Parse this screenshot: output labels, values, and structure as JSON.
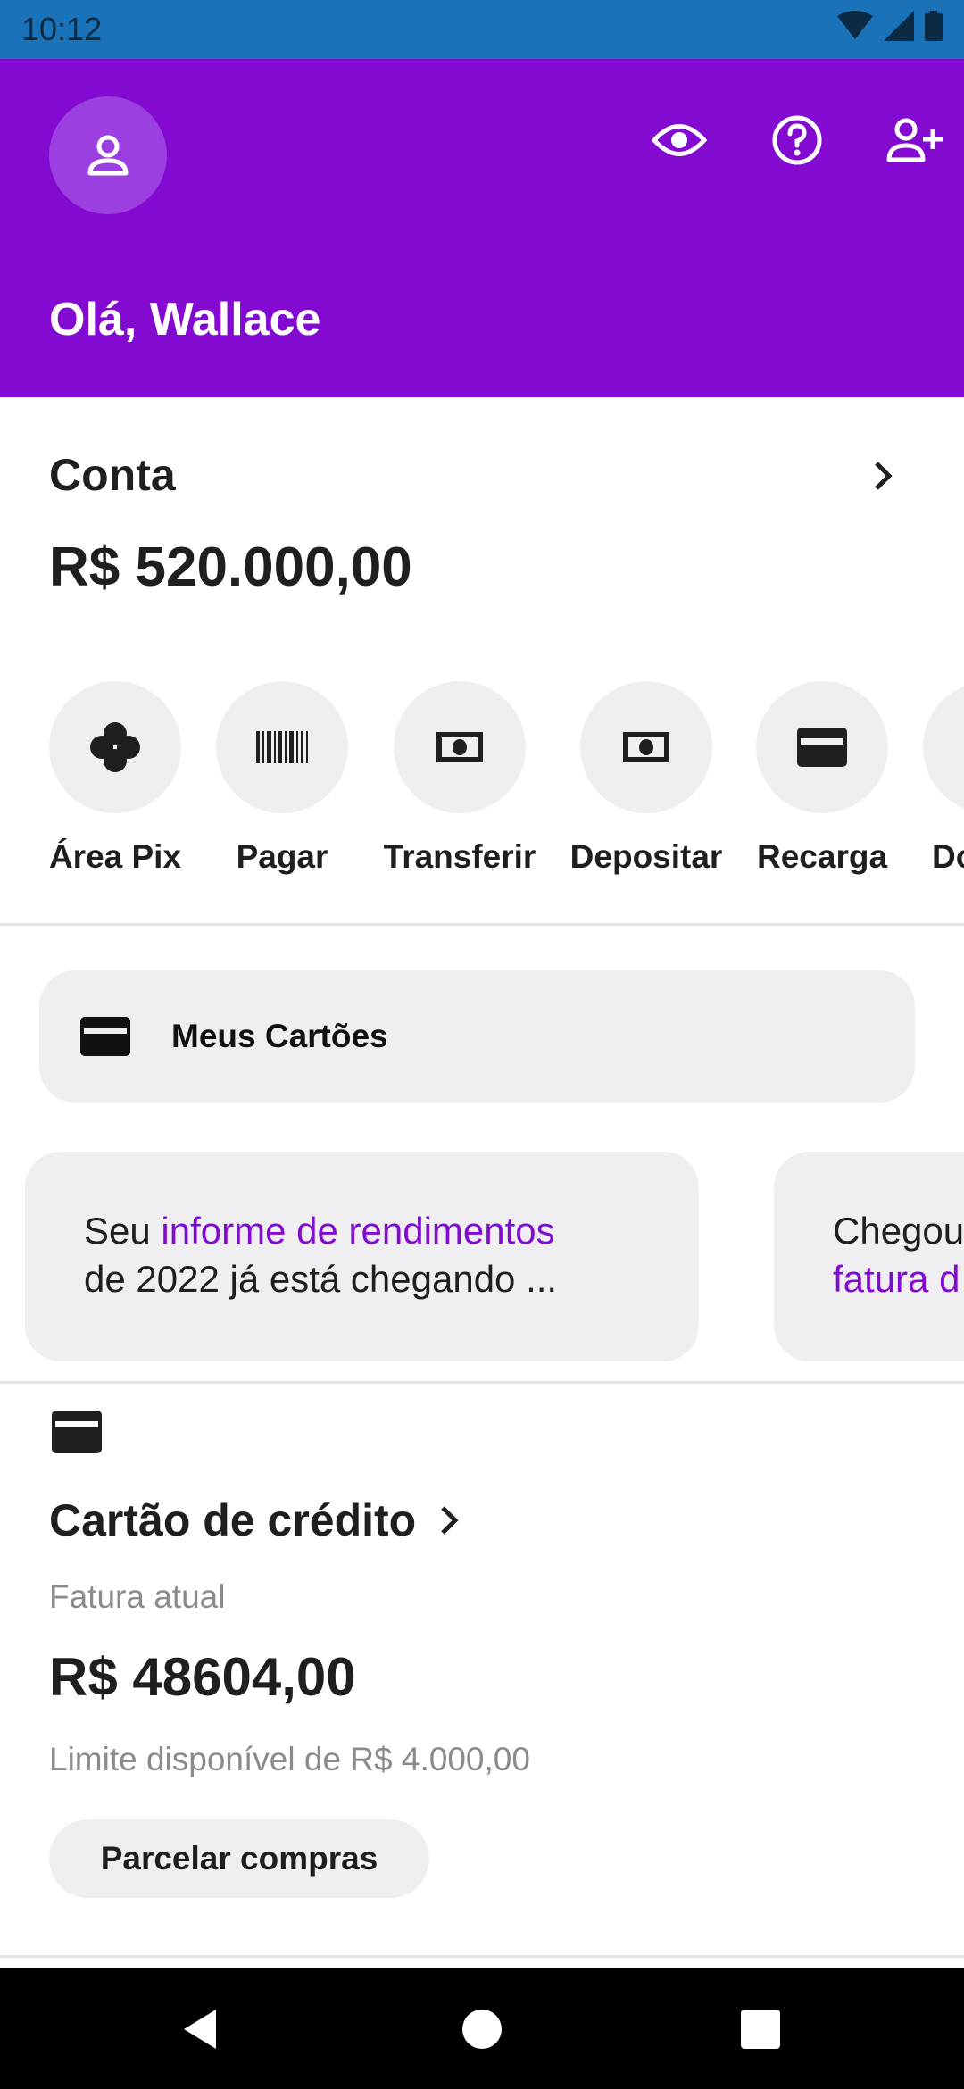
{
  "status": {
    "time": "10:12"
  },
  "header": {
    "greeting": "Olá, Wallace",
    "actions": [
      "eye-icon",
      "help-icon",
      "add-user-icon"
    ],
    "color": "#820ad1"
  },
  "account": {
    "title": "Conta",
    "balance": "R$ 520.000,00"
  },
  "shortcuts": [
    {
      "label": "Área Pix",
      "icon": "pix-icon"
    },
    {
      "label": "Pagar",
      "icon": "barcode-icon"
    },
    {
      "label": "Transferir",
      "icon": "money-icon"
    },
    {
      "label": "Depositar",
      "icon": "money-icon"
    },
    {
      "label": "Recarga",
      "icon": "card-icon"
    },
    {
      "label": "Doar",
      "icon": "donate-icon"
    }
  ],
  "cards_button": {
    "label": "Meus Cartões"
  },
  "promos": [
    {
      "line1_pre": "Seu ",
      "line1_hl": "informe de rendimentos",
      "line2": "de 2022 já está chegando ..."
    },
    {
      "line1_pre": "Chegou",
      "line1_hl": "",
      "line2_hl": "fatura d"
    }
  ],
  "credit": {
    "title": "Cartão de crédito",
    "subtitle": "Fatura atual",
    "amount": "R$ 48604,00",
    "limit": "Limite disponível de R$ 4.000,00",
    "button": "Parcelar compras"
  }
}
